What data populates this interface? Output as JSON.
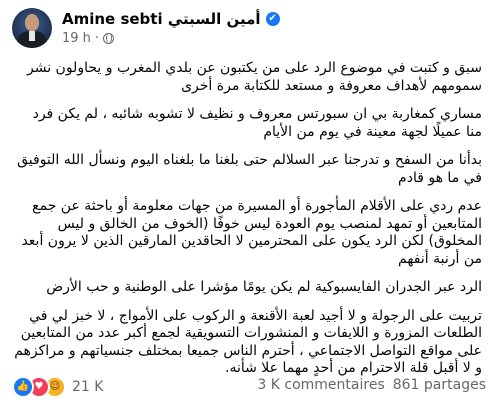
{
  "author": {
    "name": "Amine sebti أمين السبتي",
    "verified_mark": "✔",
    "time": "19 h",
    "dot": "·",
    "avatar_icon": "profile-avatar"
  },
  "post": {
    "paragraphs": [
      "سبق و كتبت في موضوع الرد على من يكتبون عن بلدي المغرب و يحاولون نشر سمومهم لأهداف معروفة و مستعد للكتابة مرة أخرى",
      "مساري كمغاربة بي ان سبورتس معروف و نظيف لا تشوبه شائبه ، لم يكن فرد منا عميلًا لجهة معينة في يوم من الأيام",
      "بدأنا من السفح و تدرجنا عبر السلالم حتى بلغنا ما بلغناه اليوم ونسأل الله التوفيق في ما هو قادم",
      "عدم ردي على الأقلام المأجورة أو المسيرة من جهات معلومة أو باحثة عن جمع المتابعين أو تمهد لمنصب يوم العودة ليس خوفًا (الخوف من الخالق و ليس المخلوق) لكن الرد يكون على المحترمين لا الحاقدين المارقين الذين لا يرون أبعد من أرنبة أنفهم",
      "الرد عبر الجدران الفايسبوكية لم يكن يومًا مؤشرا على الوطنية و حب الأرض",
      "تربيت على الرجولة و لا أجيد لعبة الأقنعة و الركوب على الأمواج ، لا خبز لي في الطلعات المزورة و اللايفات و المنشورات التسويقية لجمع أكبر عدد من المتابعين على مواقع التواصل الاجتماعي ، أحترم الناس جميعا بمختلف جنسياتهم و مراكزهم و لا أقبل قلة الاحترام من أحدٍ مهما علا شأنه."
    ]
  },
  "footer": {
    "reaction_count": "21 K",
    "comments": "3 K commentaires",
    "shares": "861 partages"
  },
  "colors": {
    "like": "#1877f2",
    "love": "#f33e58",
    "care": "#f7b125",
    "meta_gray": "#65676b"
  }
}
